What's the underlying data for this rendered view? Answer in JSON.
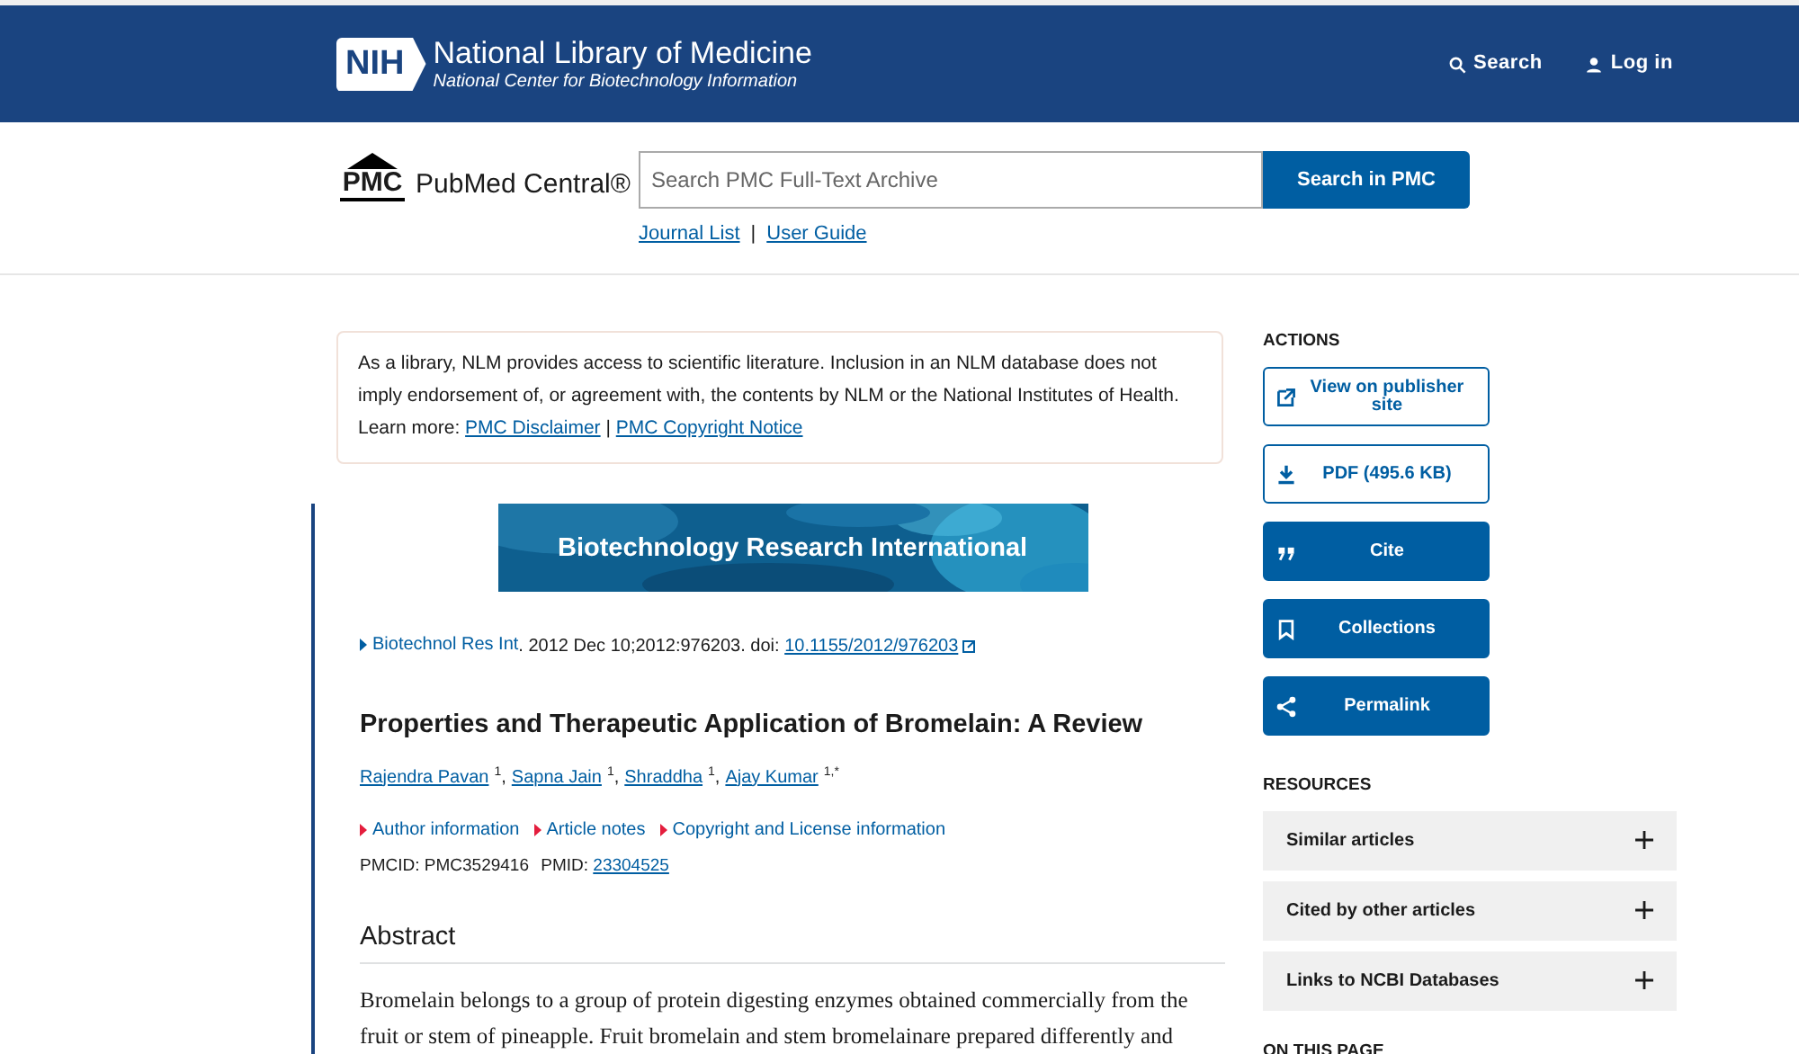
{
  "header": {
    "logo_mark": "NIH",
    "title": "National Library of Medicine",
    "subtitle": "National Center for Biotechnology Information",
    "links": [
      {
        "label": "Search"
      },
      {
        "label": "Log in"
      }
    ]
  },
  "pmc_bar": {
    "logo_mark": "PMC",
    "logo_text": "PubMed Central®",
    "search": {
      "placeholder": "Search PMC Full-Text Archive"
    },
    "search_button": "Search in PMC",
    "links": [
      "Journal List",
      "User Guide"
    ],
    "separator": "|"
  },
  "disclaimer": {
    "text": "As a library, NLM provides access to scientific literature. Inclusion in an NLM database does not imply endorsement of, or agreement with, the contents by NLM or the National Institutes of Health.",
    "learn_more": "Learn more:",
    "links": [
      "PMC Disclaimer",
      "PMC Copyright Notice"
    ],
    "separator": "|"
  },
  "article": {
    "banner": {
      "kind": "picture",
      "caption": "Biotechnology Research International"
    },
    "journal": "Biotechnol Res Int",
    "citation": ". 2012 Dec 10;2012:976203. doi: ",
    "doi": "10.1155/2012/976203",
    "title": "Properties and Therapeutic Application of Bromelain: A Review",
    "author_separator": ",",
    "authors": [
      {
        "name": "Rajendra Pavan",
        "sup": "1"
      },
      {
        "name": "Sapna Jain",
        "sup": "1"
      },
      {
        "name": "Shraddha",
        "sup": "1"
      },
      {
        "name": "Ajay Kumar",
        "sup": "1,*"
      }
    ],
    "notes": [
      "Author information",
      "Article notes",
      "Copyright and License information"
    ],
    "pmcid": "PMCID: PMC3529416",
    "pmid_label": "PMID:",
    "pmid": "23304525",
    "abstract_heading": "Abstract",
    "abstract_lines": [
      "Bromelain belongs to a group of protein digesting enzymes obtained commercially from the",
      "fruit or stem of pineapple. Fruit bromelain and stem bromelainare prepared differently and"
    ]
  },
  "sidebar": {
    "actions_heading": "ACTIONS",
    "actions": [
      {
        "label": "View on publisher site"
      },
      {
        "label": "PDF (495.6 KB)"
      },
      {
        "label": "Cite"
      },
      {
        "label": "Collections"
      },
      {
        "label": "Permalink"
      }
    ],
    "resources_heading": "RESOURCES",
    "resources": [
      {
        "label": "Similar articles",
        "expanded": false
      },
      {
        "label": "Cited by other articles",
        "expanded": false
      },
      {
        "label": "Links to NCBI Databases",
        "expanded": false
      }
    ],
    "on_this_page_heading": "ON THIS PAGE"
  }
}
